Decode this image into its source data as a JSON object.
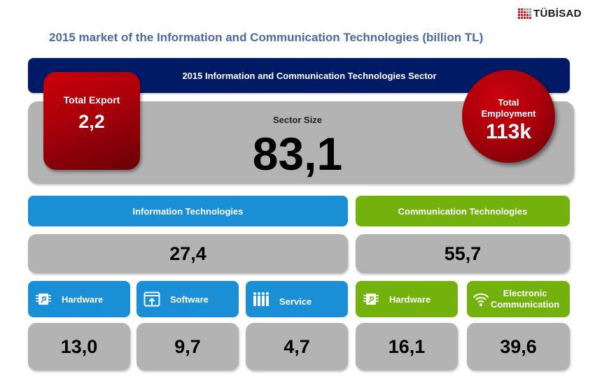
{
  "logo": {
    "text": "TÜBİSAD"
  },
  "title": "2015 market of the Information and Communication Technologies (billion TL)",
  "banner": "2015 Information and Communication Technologies Sector",
  "sector": {
    "label": "Sector Size",
    "value": "83,1"
  },
  "export": {
    "label": "Total Export",
    "value": "2,2"
  },
  "employment": {
    "label_line1": "Total",
    "label_line2": "Employment",
    "value": "113k"
  },
  "it": {
    "header": "Information Technologies",
    "value": "27,4",
    "categories": [
      {
        "label": "Hardware",
        "icon": "chip-icon",
        "value": "13,0"
      },
      {
        "label": "Software",
        "icon": "software-upload-icon",
        "value": "9,7"
      },
      {
        "label": "Service",
        "icon": "people-icon",
        "value": "4,7"
      }
    ]
  },
  "ct": {
    "header": "Communication Technologies",
    "value": "55,7",
    "categories": [
      {
        "label": "Hardware",
        "icon": "chip-icon",
        "value": "16,1"
      },
      {
        "label_line1": "Electronic",
        "label_line2": "Communication",
        "icon": "wifi-icon",
        "value": "39,6"
      }
    ]
  },
  "colors": {
    "navy": "#001a66",
    "red": "#b0000a",
    "blue": "#1a8fd6",
    "green": "#73b20d",
    "gray": "#b3b3b3",
    "title": "#4a6aa5"
  }
}
